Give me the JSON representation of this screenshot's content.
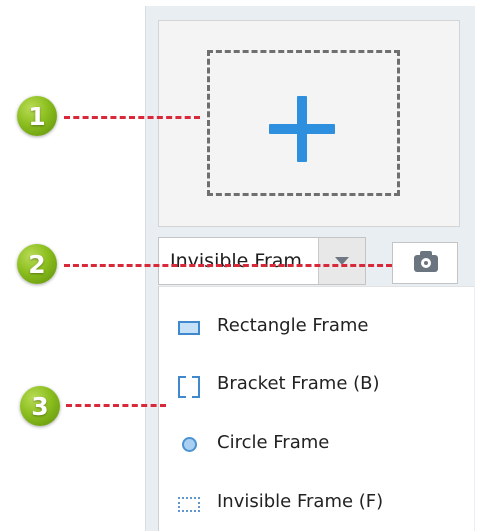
{
  "callouts": [
    {
      "number": "1"
    },
    {
      "number": "2"
    },
    {
      "number": "3"
    }
  ],
  "add_tile": {
    "icon": "plus-icon"
  },
  "frame_select": {
    "value": "Invisible Fram"
  },
  "camera_button": {
    "icon": "camera-icon"
  },
  "dropdown_menu": {
    "items": [
      {
        "label": "Rectangle Frame",
        "icon": "rectangle-frame-icon"
      },
      {
        "label": "Bracket Frame (B)",
        "icon": "bracket-frame-icon"
      },
      {
        "label": "Circle Frame",
        "icon": "circle-frame-icon"
      },
      {
        "label": "Invisible Frame (F)",
        "icon": "invisible-frame-icon"
      }
    ]
  },
  "colors": {
    "accent_blue": "#2f8fdf",
    "callout_green": "#8bbe1e",
    "leader_red": "#d9283a",
    "panel_bg": "#e9eef3"
  }
}
